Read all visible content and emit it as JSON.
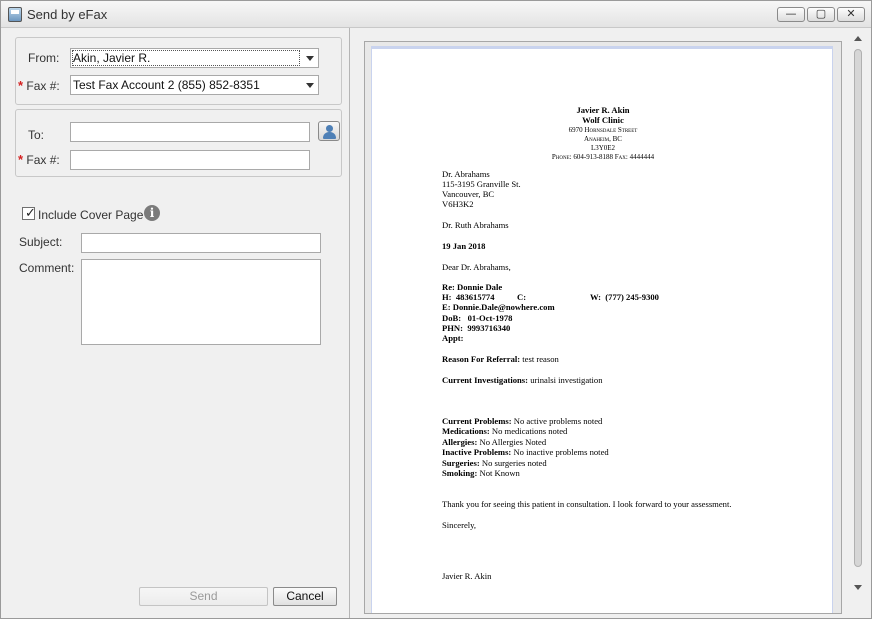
{
  "window": {
    "title": "Send by eFax",
    "minimize": "—",
    "maximize": "▢",
    "close": "✕"
  },
  "sender": {
    "from_label": "From:",
    "from_value": "Akin, Javier R.",
    "fax_label": "Fax #:",
    "fax_account": "Test Fax Account 2 (855) 852-8351",
    "required_marker": "*"
  },
  "recipient": {
    "to_label": "To:",
    "to_value": "",
    "fax_label": "Fax #:",
    "fax_value": "",
    "required_marker": "*"
  },
  "cover": {
    "include_label": "Include Cover Page",
    "include_checked": true,
    "check_glyph": "✓",
    "info_glyph": "i",
    "subject_label": "Subject:",
    "subject_value": "",
    "comment_label": "Comment:",
    "comment_value": ""
  },
  "actions": {
    "send_label": "Send",
    "cancel_label": "Cancel"
  },
  "document": {
    "header_name": "Javier R. Akin",
    "header_clinic": "Wolf Clinic",
    "header_street": "6970 Hornsdale Street",
    "header_city": "Anaheim, BC",
    "header_postal": "L3Y0E2",
    "header_phone": "Phone: 604-913-8188 Fax: 4444444",
    "recipient_name": "Dr. Abrahams",
    "recipient_street": "115-3195 Granville St.",
    "recipient_city": "Vancouver, BC",
    "recipient_postal": "V6H3K2",
    "attention": "Dr. Ruth Abrahams",
    "date": "19 Jan 2018",
    "salutation": "Dear Dr. Abrahams,",
    "re_label": "Re:",
    "re_value": "Donnie Dale",
    "h_label": "H:",
    "h_value": "483615774",
    "c_label": "C:",
    "w_label": "W:",
    "w_value": "(777) 245-9300",
    "e_label": "E:",
    "e_value": "Donnie.Dale@nowhere.com",
    "dob_label": "DoB:",
    "dob_value": "01-Oct-1978",
    "phn_label": "PHN:",
    "phn_value": "9993716340",
    "appt_label": "Appt:",
    "reason_label": "Reason For Referral:",
    "reason_value": "test reason",
    "investigations_label": "Current Investigations:",
    "investigations_value": "urinalsi investigation",
    "problems_label": "Current Problems:",
    "problems_value": "No active problems noted",
    "medications_label": "Medications:",
    "medications_value": "No medications noted",
    "allergies_label": "Allergies:",
    "allergies_value": "No Allergies Noted",
    "inactive_label": "Inactive Problems:",
    "inactive_value": "No inactive problems noted",
    "surgeries_label": "Surgeries:",
    "surgeries_value": "No surgeries noted",
    "smoking_label": "Smoking:",
    "smoking_value": "Not Known",
    "closing_text": "Thank you for seeing this patient in consultation. I look forward to your assessment.",
    "sign_off": "Sincerely,",
    "signature_name": "Javier R. Akin"
  }
}
